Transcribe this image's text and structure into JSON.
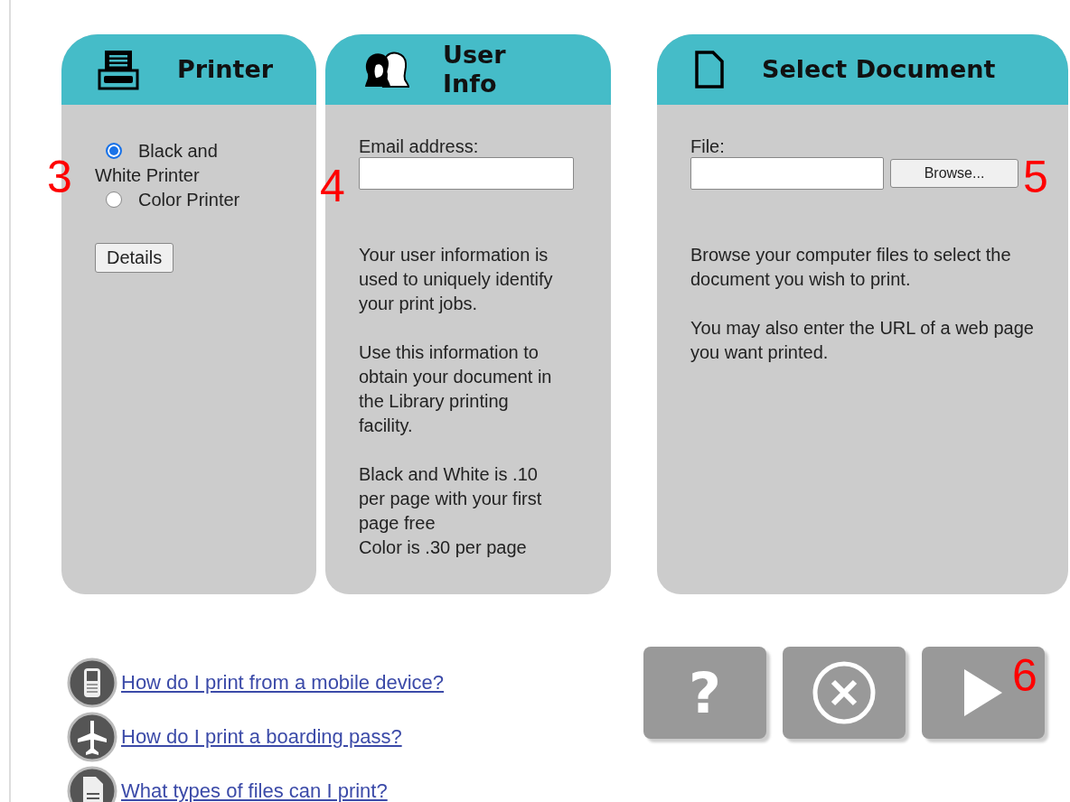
{
  "panels": [
    {
      "kind": "printer",
      "title": "Printer",
      "options": [
        {
          "label": "Black and White Printer",
          "selected": true
        },
        {
          "label": "Color Printer",
          "selected": false
        }
      ],
      "button": "Details"
    },
    {
      "kind": "user",
      "title": "User Info",
      "field_label": "Email address:",
      "paragraphs": [
        "Your user information is used to uniquely identify your print jobs.",
        "Use this information to obtain your document in the Library printing facility.",
        "Black and White is .10 per page with your first page free\nColor is .30 per page"
      ]
    },
    {
      "kind": "document",
      "title": "Select Document",
      "field_label": "File:",
      "button": "Browse...",
      "paragraphs": [
        "Browse your computer files to select the document you wish to print.",
        "You may also enter the URL of a web page you want printed."
      ]
    }
  ],
  "help_links": [
    {
      "kind": "mobile",
      "label": "How do I print from a mobile device?"
    },
    {
      "kind": "plane",
      "label": "How do I print a boarding pass?"
    },
    {
      "kind": "file",
      "label": "What types of files can I print?"
    }
  ],
  "actions": [
    {
      "kind": "help",
      "label": "?"
    },
    {
      "kind": "cancel"
    },
    {
      "kind": "next"
    }
  ],
  "step_markers": [
    "3",
    "4",
    "5",
    "6"
  ]
}
